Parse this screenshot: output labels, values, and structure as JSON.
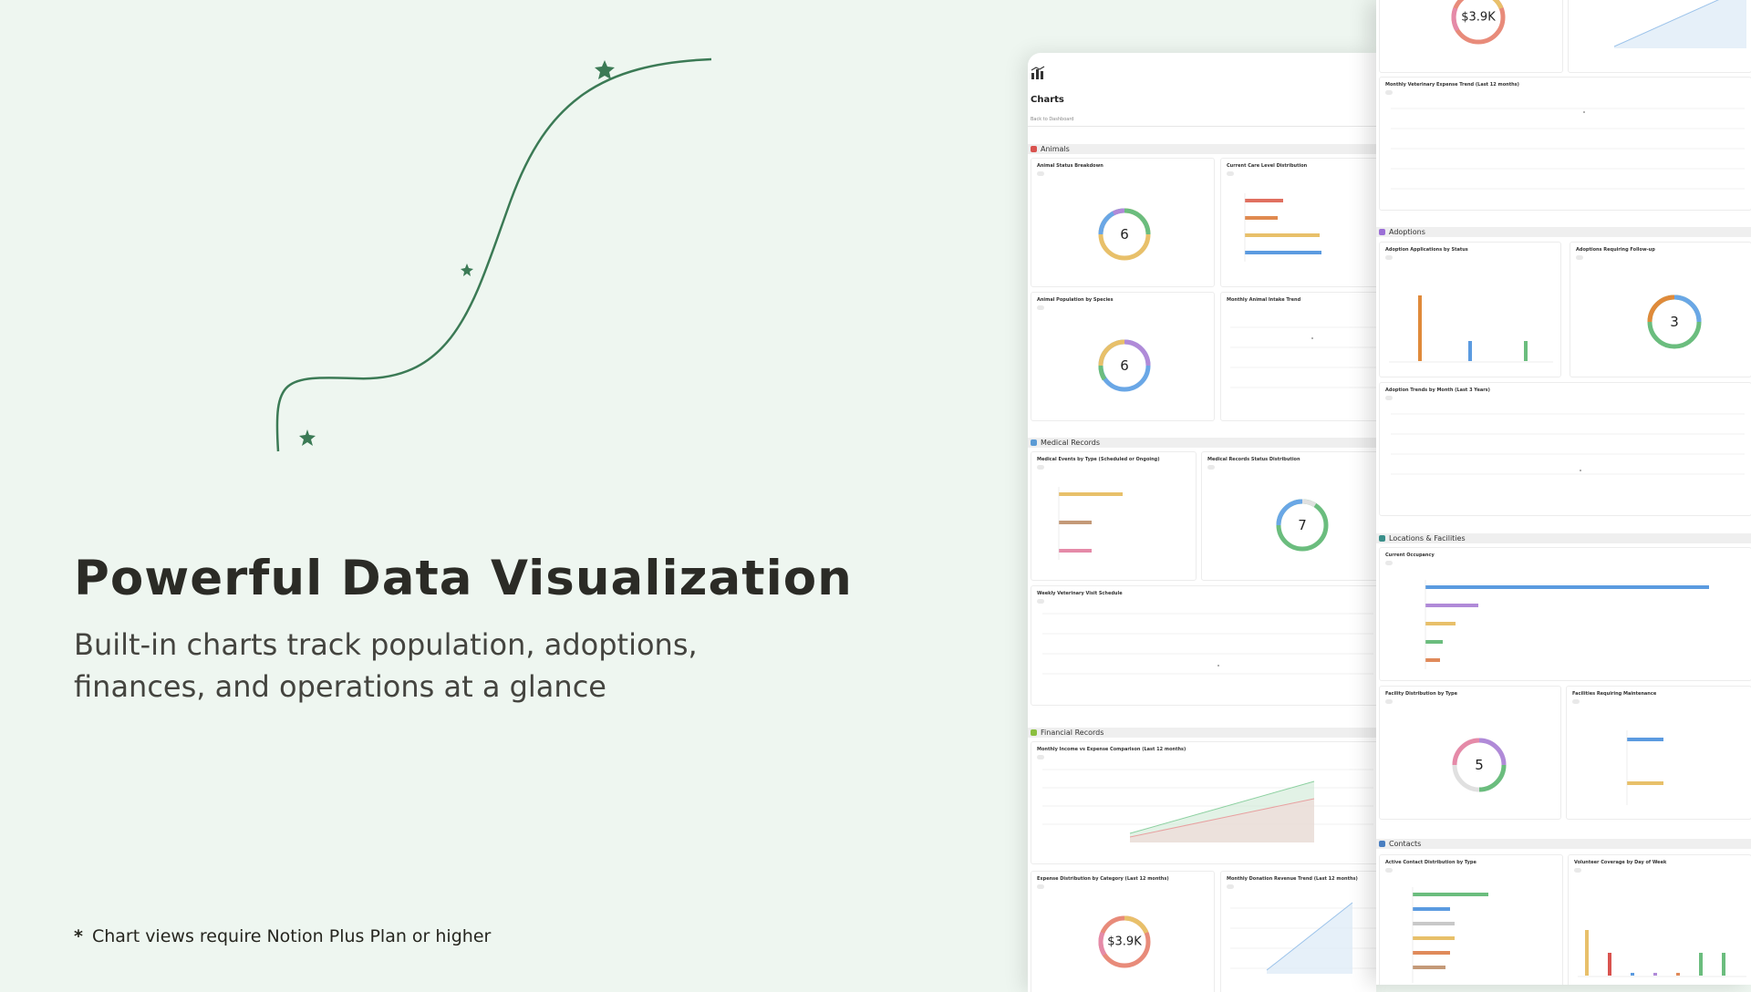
{
  "hero": {
    "title": "Powerful Data Visualization",
    "subtitle": "Built-in charts track population, adoptions, finances, and operations at a glance"
  },
  "footnote": {
    "marker": "*",
    "text": "Chart views require  Notion Plus Plan or higher"
  },
  "colors": {
    "background": "#eef6f0",
    "accent_green": "#3b7a55",
    "ring_gradient": [
      "#6aa7e6",
      "#6bbd7e",
      "#e8c06a",
      "#e88b7a",
      "#b08ad8"
    ]
  },
  "panel_left": {
    "icon": "chart-icon",
    "title": "Charts",
    "back_link": "Back to Dashboard",
    "sections": [
      {
        "label": "Animals",
        "color": "#d9534f"
      },
      {
        "label": "Medical Records",
        "color": "#5b9bd5"
      },
      {
        "label": "Financial Records",
        "color": "#8bbf3f"
      }
    ],
    "cards": {
      "animal_status": {
        "title": "Animal Status Breakdown",
        "value": "6"
      },
      "care_level": {
        "title": "Current Care Level Distribution",
        "bars": [
          0.35,
          0.3,
          0.7,
          0.72
        ]
      },
      "population_species": {
        "title": "Animal Population by Species",
        "value": "6"
      },
      "intake_trend": {
        "title": "Monthly Animal Intake Trend"
      },
      "medical_events": {
        "title": "Medical Events by Type (Scheduled or Ongoing)",
        "bars": [
          0.75,
          0.4,
          0.4
        ]
      },
      "medical_status": {
        "title": "Medical Records Status Distribution",
        "value": "7"
      },
      "vet_schedule": {
        "title": "Weekly Veterinary Visit Schedule"
      },
      "income_expense": {
        "title": "Monthly Income vs Expense Comparison (Last 12 months)"
      },
      "expense_category": {
        "title": "Expense Distribution by Category (Last 12 months)",
        "value": "$3.9K"
      },
      "donation_trend": {
        "title": "Monthly Donation Revenue Trend (Last 12 months)"
      }
    }
  },
  "panel_right": {
    "sections": [
      {
        "label": "Adoptions",
        "color": "#9b6fd6"
      },
      {
        "label": "Locations & Facilities",
        "color": "#3a8f8a"
      },
      {
        "label": "Contacts",
        "color": "#4a7fc1"
      }
    ],
    "cards": {
      "top_ring": {
        "value": "$3.9K"
      },
      "vet_expense": {
        "title": "Monthly Veterinary Expense Trend (Last 12 months)"
      },
      "adoption_status": {
        "title": "Adoption Applications by Status",
        "bars": [
          0.95,
          0.3,
          0.3
        ]
      },
      "adoption_followup": {
        "title": "Adoptions Requiring Follow-up",
        "value": "3"
      },
      "adoption_trends": {
        "title": "Adoption Trends by Month (Last 3 Years)"
      },
      "occupancy": {
        "title": "Current Occupancy",
        "bars": [
          0.95,
          0.18,
          0.1,
          0.06,
          0.05
        ]
      },
      "facility_type": {
        "title": "Facility Distribution by Type",
        "value": "5"
      },
      "facility_maintenance": {
        "title": "Facilities Requiring Maintenance",
        "bars": [
          0.65,
          0.65
        ]
      },
      "contact_type": {
        "title": "Active Contact Distribution by Type",
        "bars": [
          0.8,
          0.4,
          0.45,
          0.45,
          0.4,
          0.35
        ]
      },
      "volunteer_coverage": {
        "title": "Volunteer Coverage by Day of Week",
        "bars": [
          0.9,
          0.45,
          0.05,
          0.05,
          0.05,
          0.45,
          0.45
        ]
      }
    }
  }
}
